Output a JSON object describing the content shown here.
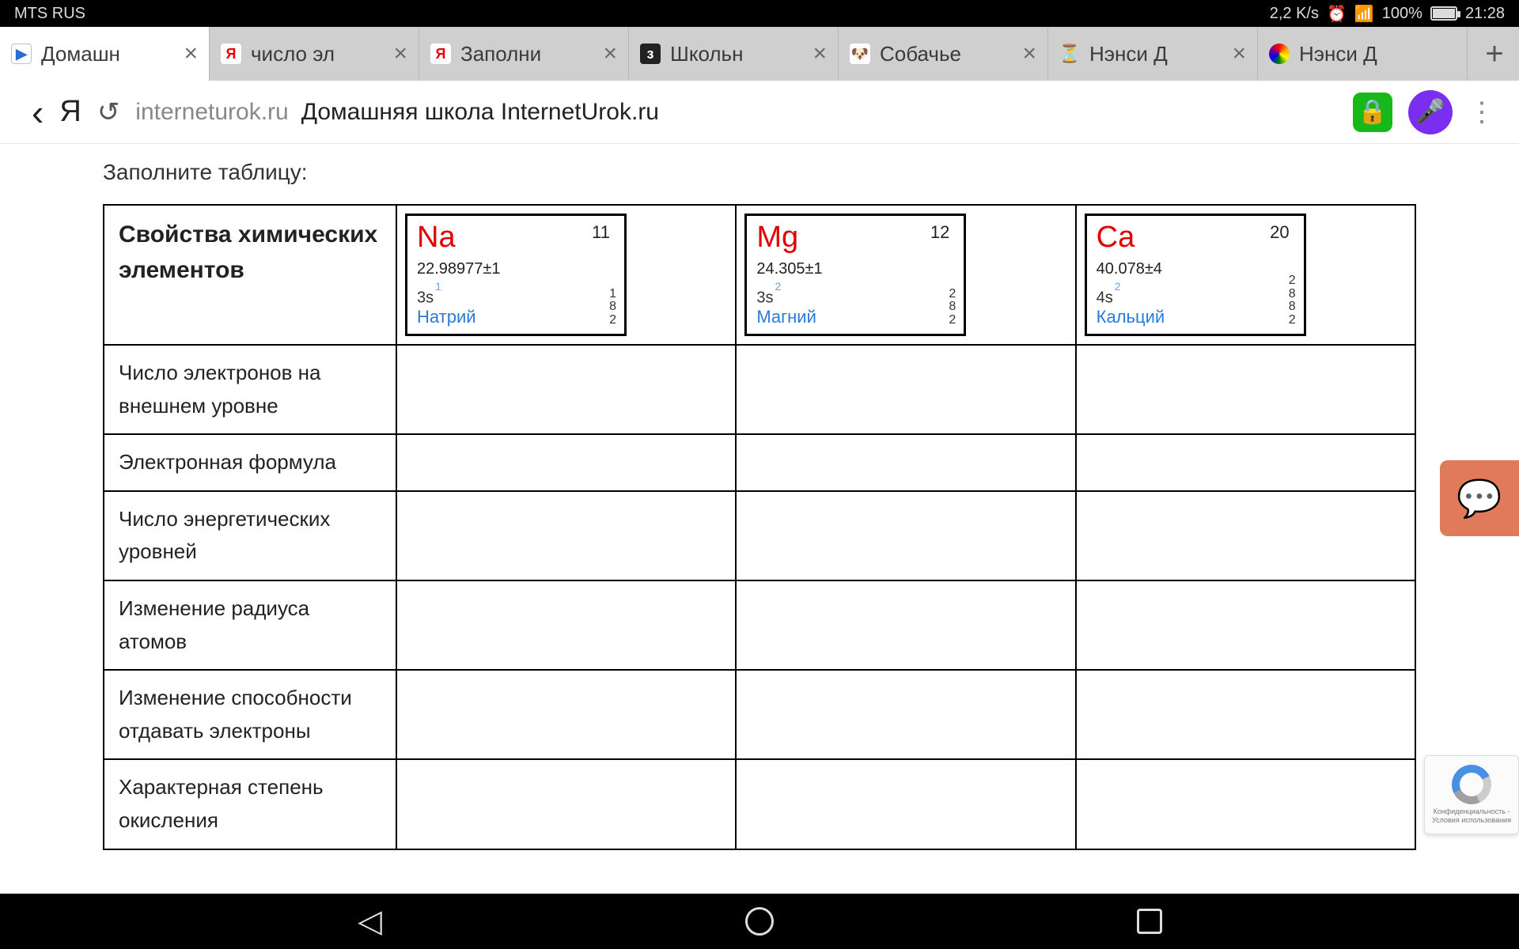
{
  "status": {
    "carrier": "MTS RUS",
    "speed": "2,2 K/s",
    "net_type": "4G",
    "battery": "100%",
    "time": "21:28"
  },
  "tabs": [
    {
      "title": "Домашн",
      "favicon": "blue",
      "glyph": "▶"
    },
    {
      "title": "число эл",
      "favicon": "ya",
      "glyph": "Я"
    },
    {
      "title": "Заполни",
      "favicon": "ya",
      "glyph": "Я"
    },
    {
      "title": "Школьн",
      "favicon": "z",
      "glyph": "з"
    },
    {
      "title": "Собачье",
      "favicon": "dog",
      "glyph": "🐶"
    },
    {
      "title": "Нэнси Д",
      "favicon": "hourglass",
      "glyph": "⏳"
    },
    {
      "title": "Нэнси Д",
      "favicon": "rainbow",
      "glyph": ""
    }
  ],
  "addr": {
    "logo": "Я",
    "domain": "interneturok.ru",
    "title": "Домашняя школа InternetUrok.ru"
  },
  "page": {
    "instruction": "Заполните таблицу:",
    "header": "Свойства химических элементов",
    "elements": [
      {
        "symbol": "Na",
        "number": "11",
        "mass": "22.98977±1",
        "orbital": "3s",
        "orbital_sup": "1",
        "name": "Натрий",
        "shells": [
          "1",
          "8",
          "2"
        ]
      },
      {
        "symbol": "Mg",
        "number": "12",
        "mass": "24.305±1",
        "orbital": "3s",
        "orbital_sup": "2",
        "name": "Магний",
        "shells": [
          "2",
          "8",
          "2"
        ]
      },
      {
        "symbol": "Ca",
        "number": "20",
        "mass": "40.078±4",
        "orbital": "4s",
        "orbital_sup": "2",
        "name": "Кальций",
        "shells": [
          "2",
          "8",
          "8",
          "2"
        ]
      }
    ],
    "rows": [
      "Число электронов на внешнем уровне",
      "Электронная формула",
      "Число энергетических уровней",
      "Изменение радиуса атомов",
      "Изменение способности отдавать электроны",
      "Характерная степень окисления"
    ]
  },
  "recaptcha": {
    "line1": "Конфиденциальность  -",
    "line2": "Условия использования"
  }
}
